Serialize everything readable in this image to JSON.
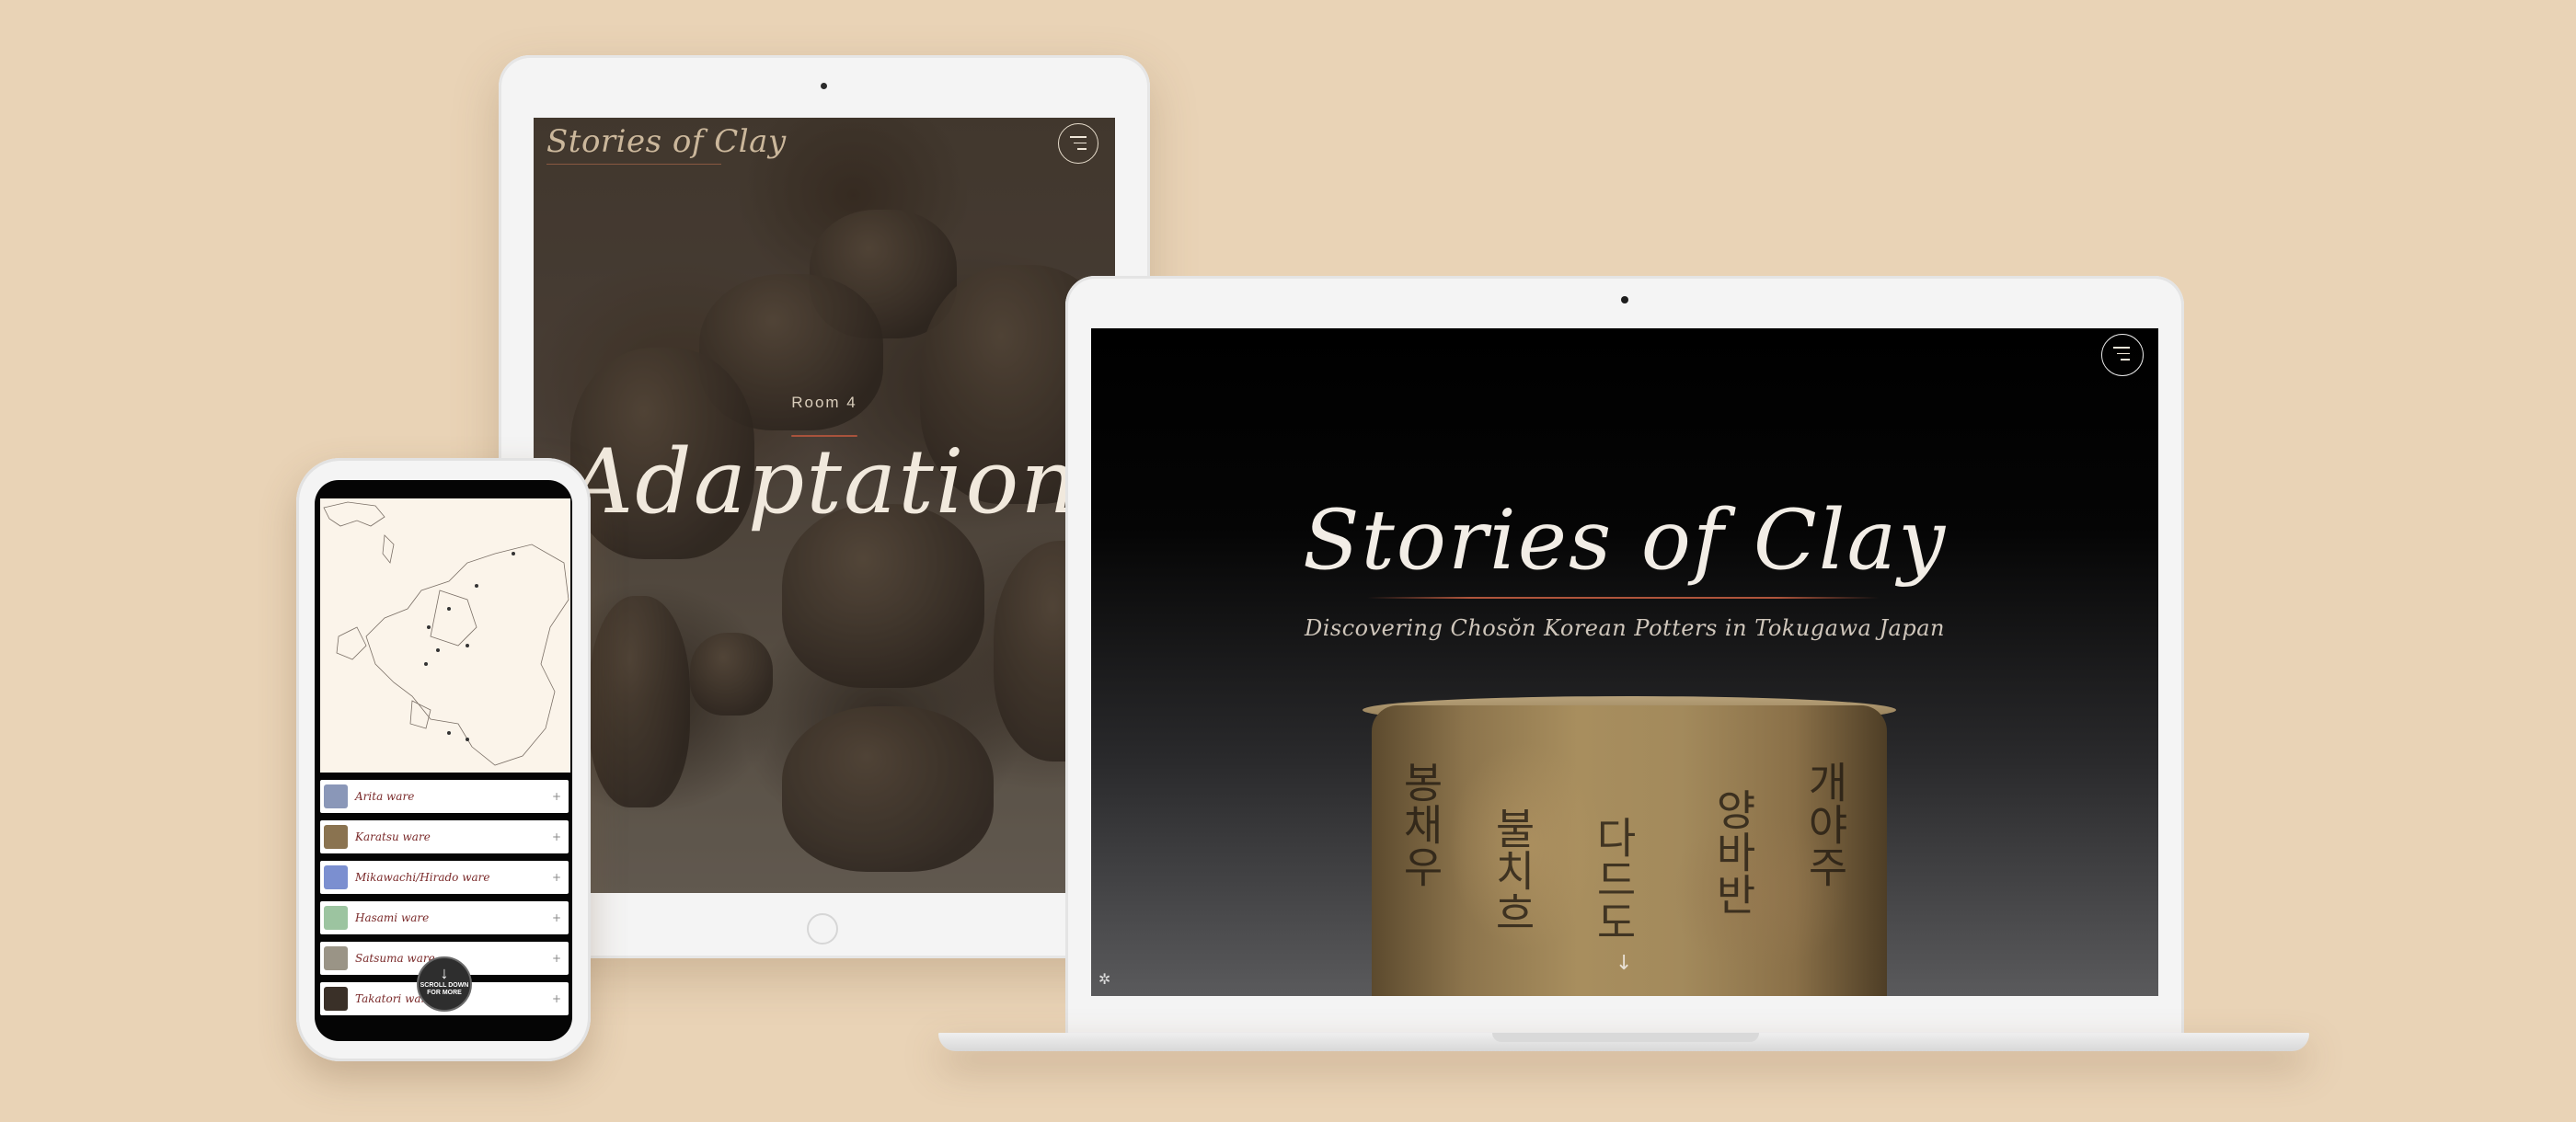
{
  "tablet": {
    "logo": "Stories of Clay",
    "room_label": "Room 4",
    "room_title": "Adaptation"
  },
  "laptop": {
    "title": "Stories of Clay",
    "subtitle": "Discovering Chosŏn Korean Potters in Tokugawa Japan",
    "scroll_arrow": "↓"
  },
  "phone": {
    "wares": [
      {
        "label": "Arita ware",
        "plus": "+",
        "thumb_color": "#8a97b8"
      },
      {
        "label": "Karatsu ware",
        "plus": "+",
        "thumb_color": "#8a7350"
      },
      {
        "label": "Mikawachi/Hirado ware",
        "plus": "+",
        "thumb_color": "#7b8fd0"
      },
      {
        "label": "Hasami ware",
        "plus": "+",
        "thumb_color": "#9cc4a0"
      },
      {
        "label": "Satsuma ware",
        "plus": "+",
        "thumb_color": "#9a9486"
      },
      {
        "label": "Takatori ware",
        "plus": "+",
        "thumb_color": "#3a3028"
      }
    ],
    "scroll_button": {
      "arrow": "↓",
      "line1": "SCROLL DOWN",
      "line2": "FOR MORE"
    }
  },
  "colors": {
    "background": "#e9d3b6",
    "accent": "#a8533c",
    "ware_text": "#7a2a2a"
  }
}
